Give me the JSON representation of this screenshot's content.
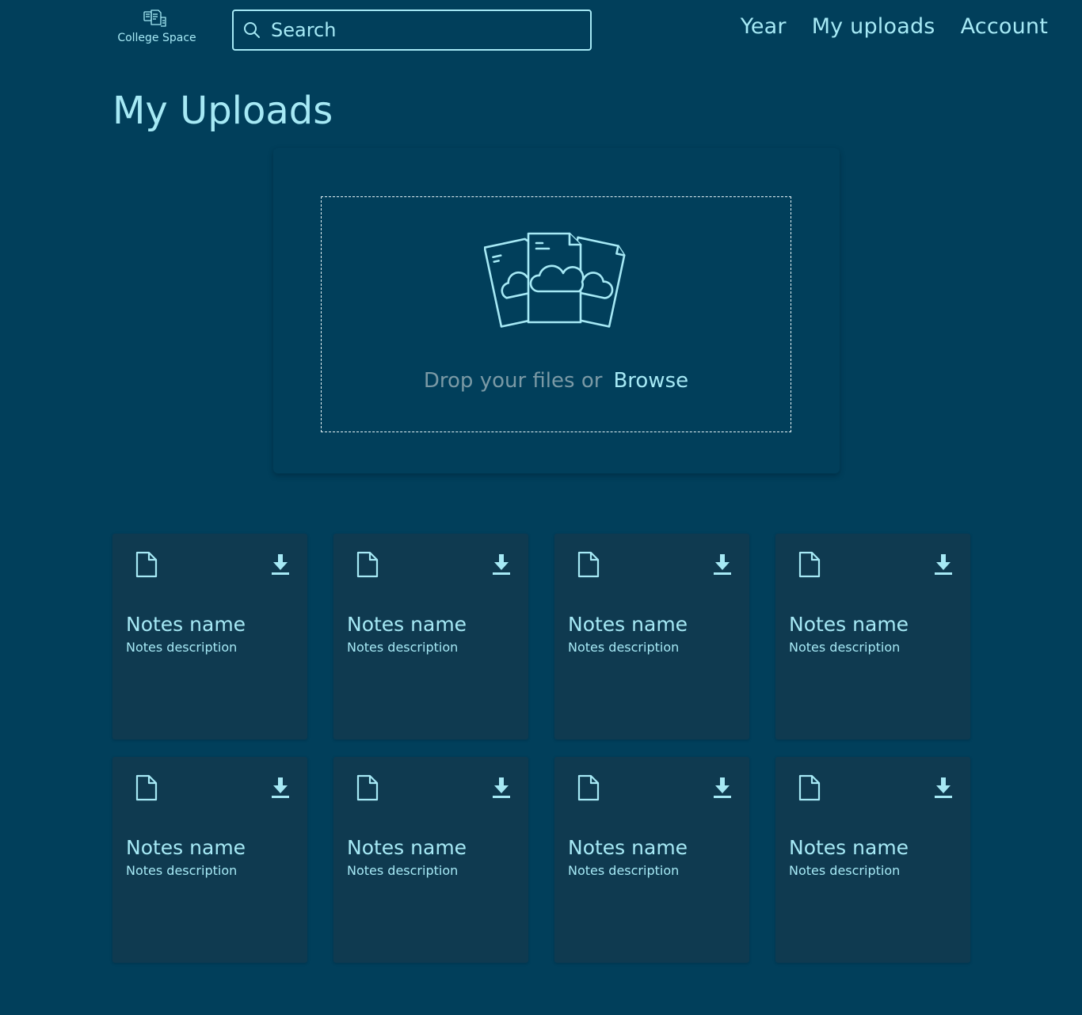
{
  "header": {
    "logo_text": "College Space",
    "search": {
      "placeholder": "Search",
      "value": ""
    },
    "nav": [
      {
        "label": "Year"
      },
      {
        "label": "My uploads"
      },
      {
        "label": "Account"
      }
    ]
  },
  "page": {
    "title": "My Uploads"
  },
  "upload": {
    "drop_text": "Drop your files or",
    "browse_label": "Browse"
  },
  "notes": [
    {
      "name": "Notes name",
      "description": "Notes description"
    },
    {
      "name": "Notes name",
      "description": "Notes description"
    },
    {
      "name": "Notes name",
      "description": "Notes description"
    },
    {
      "name": "Notes name",
      "description": "Notes description"
    },
    {
      "name": "Notes name",
      "description": "Notes description"
    },
    {
      "name": "Notes name",
      "description": "Notes description"
    },
    {
      "name": "Notes name",
      "description": "Notes description"
    },
    {
      "name": "Notes name",
      "description": "Notes description"
    }
  ],
  "icons": {
    "logo": "college-space-logo-icon",
    "search": "search-icon",
    "upload": "cloud-files-icon",
    "file": "file-icon",
    "download": "download-icon"
  },
  "colors": {
    "background": "#013f5b",
    "card": "#0f3a50",
    "accent": "#a6e9f5",
    "muted_text": "#7a99a5",
    "dashed_border": "#e6f3f6"
  }
}
